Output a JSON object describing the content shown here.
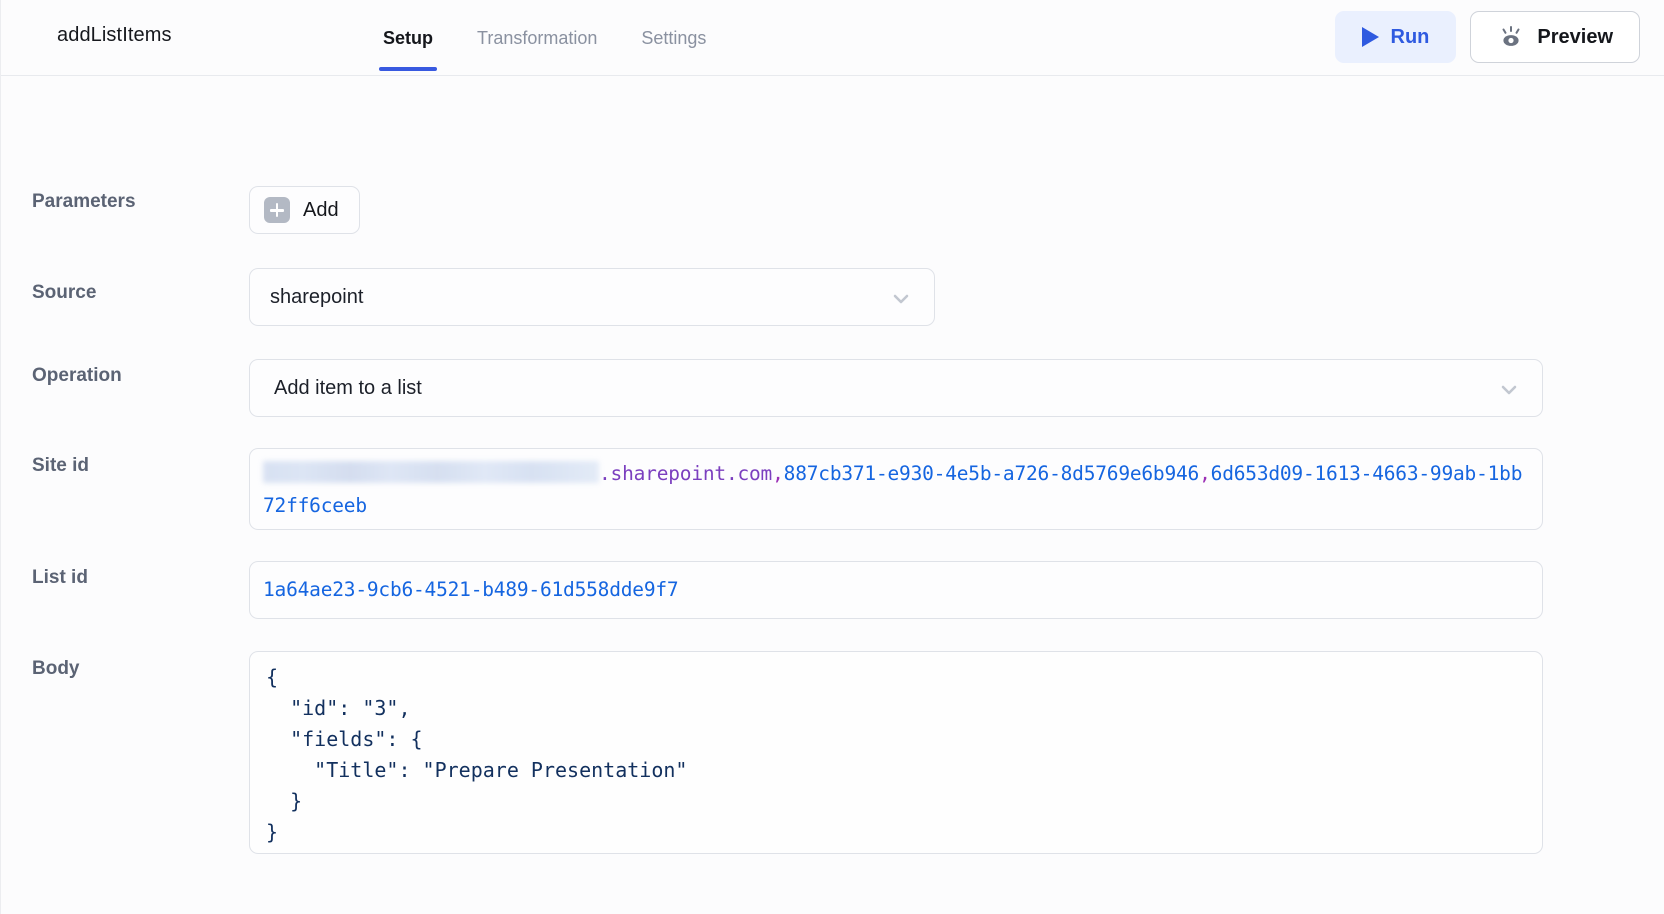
{
  "header": {
    "node_title": "addListItems",
    "tabs": [
      {
        "label": "Setup",
        "active": true
      },
      {
        "label": "Transformation",
        "active": false
      },
      {
        "label": "Settings",
        "active": false
      }
    ],
    "run_button": "Run",
    "preview_button": "Preview",
    "accent_color": "#3859e0",
    "run_bg_color": "#eaf0fe"
  },
  "form": {
    "parameters": {
      "label": "Parameters",
      "add_button": "Add"
    },
    "source": {
      "label": "Source",
      "value": "sharepoint"
    },
    "operation": {
      "label": "Operation",
      "value": "Add item to a list"
    },
    "site_id": {
      "label": "Site id",
      "redacted_prefix": "",
      "domain": ".sharepoint.com",
      "separator_1": ",",
      "guid_1": "887cb371-e930-4e5b-a726-8d5769e6b946",
      "separator_2": ",",
      "guid_2": "6d653d09-1613-4663-99ab-1bb72ff6ceeb"
    },
    "list_id": {
      "label": "List id",
      "value": "1a64ae23-9cb6-4521-b489-61d558dde9f7"
    },
    "body": {
      "label": "Body",
      "value": "{\n  \"id\": \"3\",\n  \"fields\": {\n    \"Title\": \"Prepare Presentation\"\n  }\n}"
    }
  }
}
